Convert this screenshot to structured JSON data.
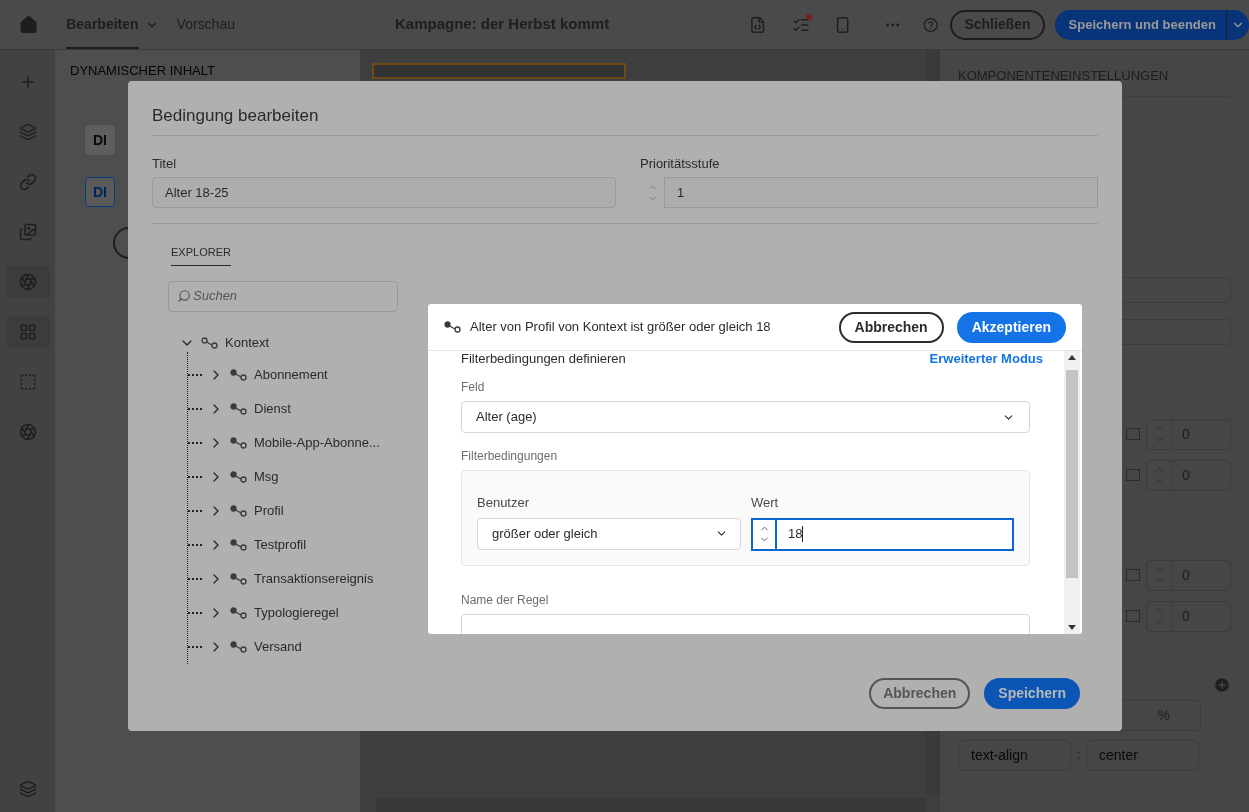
{
  "app_bar": {
    "tabs": [
      {
        "label": "Bearbeiten",
        "selected": true
      },
      {
        "label": "Vorschau",
        "selected": false
      }
    ],
    "title": "Kampagne: der Herbst kommt",
    "close_button": "Schließen",
    "save_button": "Speichern und beenden"
  },
  "left_panel": {
    "heading": "DYNAMISCHER INHALT",
    "badges": [
      {
        "label": "DI",
        "selected": false
      },
      {
        "label": "DI",
        "selected": true
      }
    ]
  },
  "right_panel": {
    "heading": "KOMPONENTENEINSTELLUNGEN",
    "spacing_values": [
      "0",
      "0",
      "0",
      "0"
    ],
    "percent_value": "%",
    "style_row": {
      "property": "text-align",
      "separator": ":",
      "value": "center"
    }
  },
  "dialog": {
    "title": "Bedingung bearbeiten",
    "title_field": {
      "label": "Titel",
      "value": "Alter 18-25"
    },
    "priority_field": {
      "label": "Prioritätsstufe",
      "value": "1"
    },
    "explorer_tab": "EXPLORER",
    "search_placeholder": "Suchen",
    "tree": [
      {
        "label": "Kontext",
        "expanded": true,
        "children": [
          {
            "label": "Abonnement",
            "expanded": false
          },
          {
            "label": "Dienst",
            "expanded": false
          },
          {
            "label": "Mobile-App-Abonne...",
            "expanded": false
          },
          {
            "label": "Msg",
            "expanded": false
          },
          {
            "label": "Profil",
            "expanded": false
          },
          {
            "label": "Testprofil",
            "expanded": false
          },
          {
            "label": "Transaktionsereignis",
            "expanded": false
          },
          {
            "label": "Typologieregel",
            "expanded": false
          },
          {
            "label": "Versand",
            "expanded": false
          }
        ]
      }
    ],
    "cancel_button": "Abbrechen",
    "save_button": "Speichern"
  },
  "condition_dialog": {
    "summary": "Alter von Profil von Kontext ist größer oder gleich 18",
    "cancel_button": "Abbrechen",
    "accept_button": "Akzeptieren",
    "section_title": "Filterbedingungen definieren",
    "advanced_link": "Erweiterter Modus",
    "field": {
      "label": "Feld",
      "value": "Alter (age)"
    },
    "conditions_label": "Filterbedingungen",
    "operator": {
      "label": "Benutzer",
      "value": "größer oder gleich"
    },
    "value": {
      "label": "Wert",
      "value": "18"
    },
    "rule_name": {
      "label": "Name der Regel"
    }
  }
}
